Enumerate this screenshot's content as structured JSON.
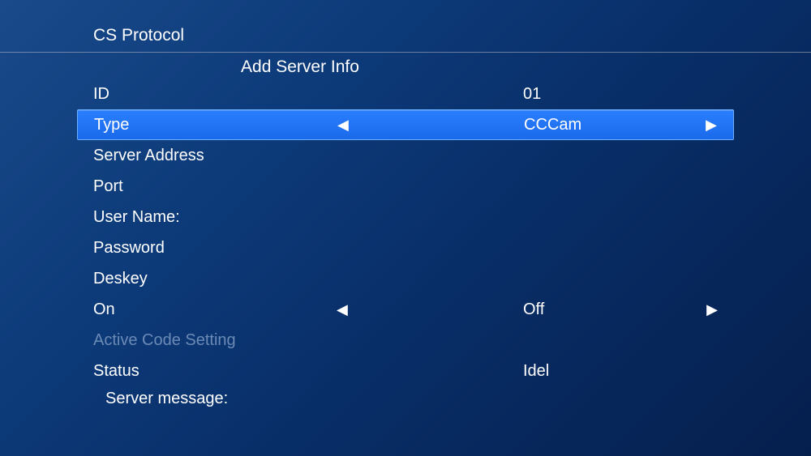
{
  "header": {
    "title": "CS Protocol"
  },
  "screen_title": "Add Server Info",
  "fields": {
    "id": {
      "label": "ID",
      "value": "01"
    },
    "type": {
      "label": "Type",
      "value": "CCCam"
    },
    "server_address": {
      "label": "Server Address",
      "value": ""
    },
    "port": {
      "label": "Port",
      "value": ""
    },
    "user_name": {
      "label": "User Name:",
      "value": ""
    },
    "password": {
      "label": "Password",
      "value": ""
    },
    "deskey": {
      "label": "Deskey",
      "value": ""
    },
    "on": {
      "label": "On",
      "value": "Off"
    },
    "active_code": {
      "label": "Active Code Setting",
      "value": ""
    },
    "status": {
      "label": "Status",
      "value": "Idel"
    },
    "server_message": {
      "label": "Server message:",
      "value": ""
    }
  },
  "glyphs": {
    "arrow_left": "◀",
    "arrow_right": "▶"
  }
}
